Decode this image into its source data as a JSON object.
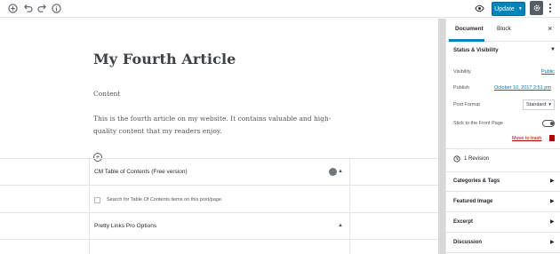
{
  "toolbar": {
    "add_icon": "plus-circle-icon",
    "undo_icon": "undo-icon",
    "redo_icon": "redo-icon",
    "info_icon": "info-icon",
    "preview_icon": "eye-icon",
    "update_label": "Update",
    "settings_icon": "gear-icon",
    "more_icon": "vertical-ellipsis-icon",
    "accent_color": "#0085ba"
  },
  "editor": {
    "title": "My Fourth Article",
    "content_label": "Content",
    "paragraph": "This is the fourth article on my website. It contains valuable and high-quality content that my readers enjoy."
  },
  "metaboxes": {
    "toc_title": "CM Table of Contents (Free version)",
    "toc_checkbox_label": "Search for Table Of Contents items on this post/page.",
    "pretty_links_title": "Pretty Links Pro Options"
  },
  "sidebar": {
    "tabs": [
      {
        "label": "Document",
        "active": true
      },
      {
        "label": "Block",
        "active": false
      }
    ],
    "close_label": "×",
    "status_visibility": {
      "title": "Status & Visibility",
      "visibility_label": "Visibility",
      "visibility_value": "Public",
      "publish_label": "Publish",
      "publish_value": "October 10, 2017 2:51 pm",
      "post_format_label": "Post Format",
      "post_format_value": "Standard",
      "sticky_label": "Stick to the Front Page",
      "sticky_on": false,
      "trash_label": "Move to trash"
    },
    "revisions": "1 Revision",
    "panels": [
      {
        "title": "Categories & Tags"
      },
      {
        "title": "Featured Image"
      },
      {
        "title": "Excerpt"
      },
      {
        "title": "Discussion"
      }
    ]
  }
}
